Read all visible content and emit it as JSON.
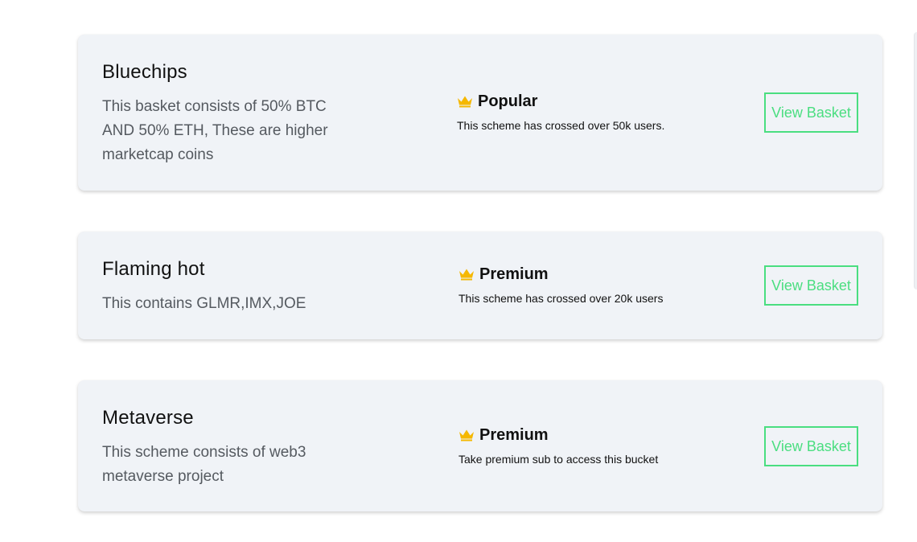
{
  "colors": {
    "card_background": "#f0f3f7",
    "accent_green": "#4ade80",
    "crown_gold": "#f5b800",
    "title_text": "#111111",
    "description_text": "#555a60"
  },
  "baskets": [
    {
      "title": "Bluechips",
      "description": "This basket consists of 50% BTC AND 50% ETH, These are higher marketcap coins",
      "tier_icon": "crown-icon",
      "tier": "Popular",
      "tier_note": "This scheme has crossed over 50k users.",
      "button_label": "View Basket"
    },
    {
      "title": "Flaming hot",
      "description": "This contains GLMR,IMX,JOE",
      "tier_icon": "crown-icon",
      "tier": "Premium",
      "tier_note": "This scheme has crossed over 20k users",
      "button_label": "View Basket"
    },
    {
      "title": "Metaverse",
      "description": "This scheme consists of web3 metaverse project",
      "tier_icon": "crown-icon",
      "tier": "Premium",
      "tier_note": "Take premium sub to access this bucket",
      "button_label": "View Basket"
    }
  ]
}
